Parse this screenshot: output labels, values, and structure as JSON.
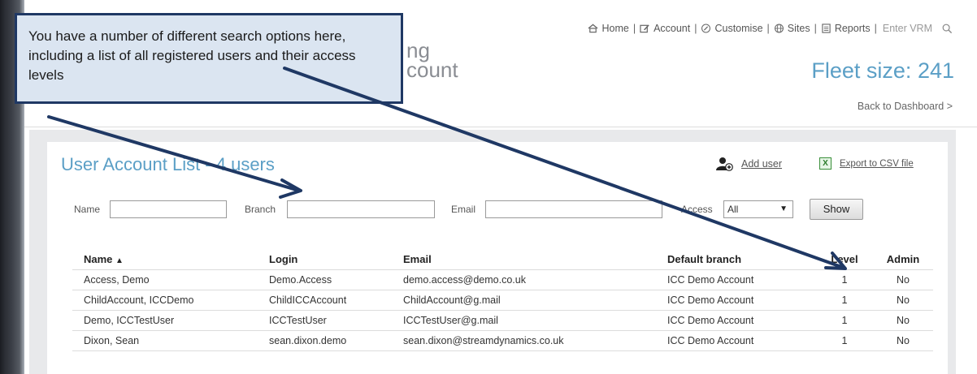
{
  "nav": {
    "home": "Home",
    "account": "Account",
    "customise": "Customise",
    "sites": "Sites",
    "reports": "Reports",
    "separator": "|",
    "vrm_placeholder": "Enter VRM"
  },
  "header": {
    "brand_fragment_1": "ng",
    "brand_fragment_2": "count",
    "fleet_label": "Fleet size:",
    "fleet_value": "241",
    "back_link": "Back to Dashboard >"
  },
  "panel": {
    "title": "User Account List - 4 users",
    "add_user": "Add user",
    "export": "Export to CSV file"
  },
  "filters": {
    "name_label": "Name",
    "branch_label": "Branch",
    "email_label": "Email",
    "access_label": "Access",
    "access_value": "All",
    "show_button": "Show"
  },
  "table": {
    "headers": {
      "name": "Name",
      "sort_indicator": "▲",
      "login": "Login",
      "email": "Email",
      "branch": "Default branch",
      "level": "Level",
      "admin": "Admin"
    },
    "rows": [
      {
        "name": "Access, Demo",
        "login": "Demo.Access",
        "email": "demo.access@demo.co.uk",
        "branch": "ICC Demo Account",
        "level": "1",
        "admin": "No"
      },
      {
        "name": "ChildAccount, ICCDemo",
        "login": "ChildICCAccount",
        "email": "ChildAccount@g.mail",
        "branch": "ICC Demo Account",
        "level": "1",
        "admin": "No"
      },
      {
        "name": "Demo, ICCTestUser",
        "login": "ICCTestUser",
        "email": "ICCTestUser@g.mail",
        "branch": "ICC Demo Account",
        "level": "1",
        "admin": "No"
      },
      {
        "name": "Dixon, Sean",
        "login": "sean.dixon.demo",
        "email": "sean.dixon@streamdynamics.co.uk",
        "branch": "ICC Demo Account",
        "level": "1",
        "admin": "No"
      }
    ]
  },
  "callout": {
    "text": "You have a number of different search options here, including a list of all registered users and their access levels"
  },
  "colors": {
    "accent_blue": "#5b9fc6",
    "callout_fill": "#dbe5f1",
    "callout_border": "#1f3864",
    "arrow": "#1f3864"
  },
  "icons": [
    "home-icon",
    "edit-icon",
    "customise-icon",
    "globe-icon",
    "report-icon",
    "search-icon",
    "add-user-icon",
    "excel-icon"
  ]
}
